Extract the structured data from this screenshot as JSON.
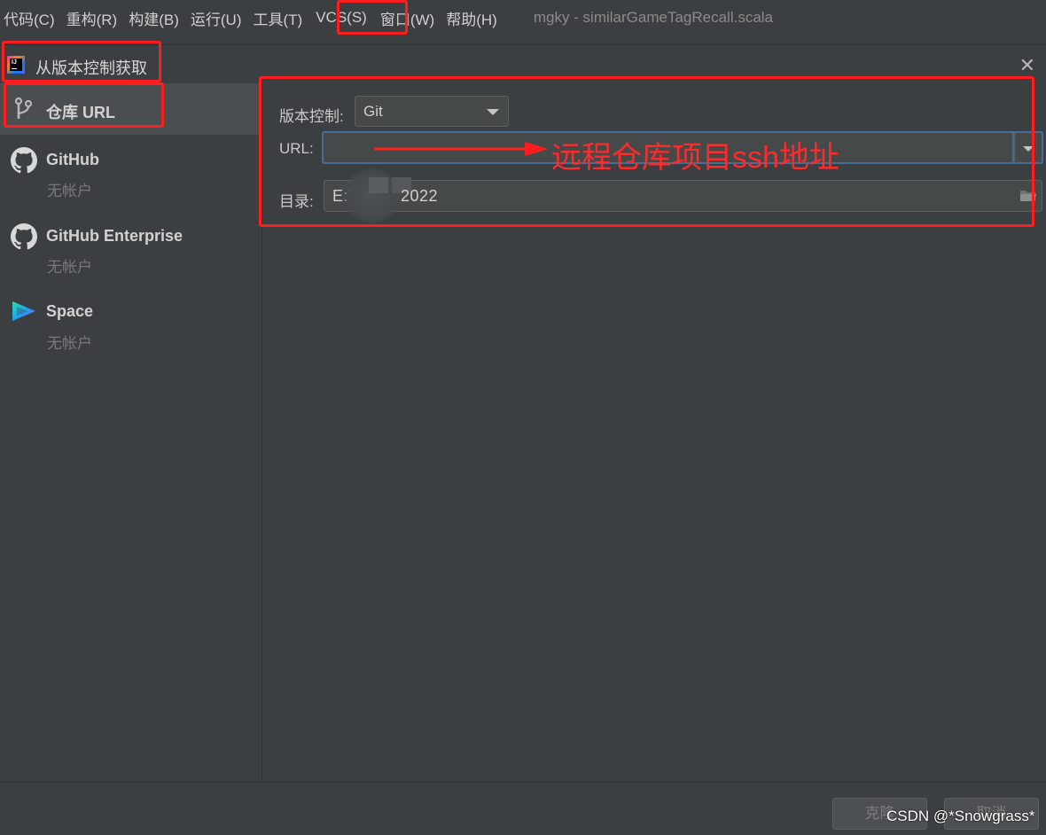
{
  "menu": {
    "items": [
      "代码(C)",
      "重构(R)",
      "构建(B)",
      "运行(U)",
      "工具(T)",
      "VCS(S)",
      "窗口(W)",
      "帮助(H)"
    ],
    "window_title": "mgky - similarGameTagRecall.scala"
  },
  "dialog": {
    "title": "从版本控制获取",
    "close_icon": "close-icon"
  },
  "sidebar": {
    "items": [
      {
        "label": "仓库 URL",
        "sub": "",
        "icon": "git-branch-icon"
      },
      {
        "label": "GitHub",
        "sub": "无帐户",
        "icon": "github-icon"
      },
      {
        "label": "GitHub Enterprise",
        "sub": "无帐户",
        "icon": "github-icon"
      },
      {
        "label": "Space",
        "sub": "无帐户",
        "icon": "space-icon"
      }
    ]
  },
  "form": {
    "vcs_label": "版本控制:",
    "vcs_value": "Git",
    "url_label": "URL:",
    "url_value": "",
    "dir_label": "目录:",
    "dir_value_prefix": "E:\\",
    "dir_value_suffix": "2022"
  },
  "annotation": {
    "text": "远程仓库项目ssh地址",
    "color": "#ff1e1e"
  },
  "buttons": {
    "clone": "克隆",
    "cancel": "取消"
  },
  "watermark": "CSDN @*Snowgrass*",
  "colors": {
    "background": "#3c3f41",
    "selected": "#4b4e50",
    "focus_border": "#466d94"
  }
}
